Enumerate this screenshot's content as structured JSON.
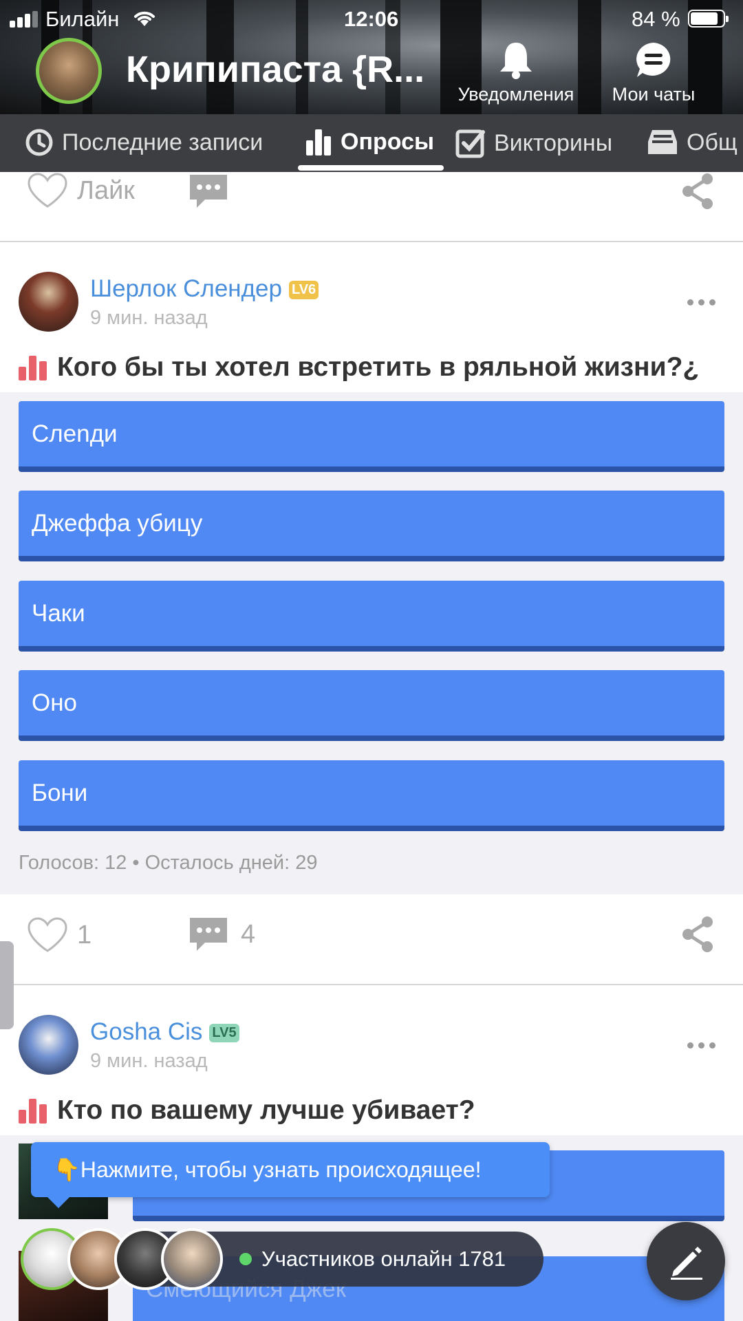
{
  "status_bar": {
    "carrier": "Билайн",
    "time": "12:06",
    "battery_text": "84 %"
  },
  "header": {
    "community_title": "Крипипаста {R...",
    "notifications_label": "Уведомления",
    "chats_label": "Мои чаты"
  },
  "tabs": [
    {
      "label": "Последние записи",
      "icon": "clock-icon",
      "active": false
    },
    {
      "label": "Опросы",
      "icon": "bar-chart-icon",
      "active": true
    },
    {
      "label": "Викторины",
      "icon": "checkbox-icon",
      "active": false
    },
    {
      "label": "Общ",
      "icon": "inbox-icon",
      "active": false
    }
  ],
  "prev_post_actions": {
    "like_label": "Лайк"
  },
  "posts": [
    {
      "author": "Шерлок Слендер",
      "level": "LV6",
      "time": "9 мин. назад",
      "title": "Кого бы ты хотел встретить в ряльной жизни?¿",
      "options": [
        "Слenди",
        "Джеффа убицу",
        "Чаки",
        "Оно",
        "Бони"
      ],
      "votes_text": "Голосов: 12 • Осталось дней: 29",
      "likes": "1",
      "comments": "4"
    },
    {
      "author": "Gosha Cis",
      "level": "LV5",
      "time": "9 мин. назад",
      "title": "Кто по вашему лучше убивает?",
      "options": [
        "",
        "Смеющийся Джек"
      ]
    }
  ],
  "tooltip": {
    "text": "👇Нажмите, чтобы узнать происходящее!"
  },
  "online": {
    "text": "Участников онлайн 1781"
  },
  "colors": {
    "accent_blue": "#5089f3",
    "tab_bar": "#3d3e42",
    "author_link": "#4a8fdb",
    "online_green": "#5ed66a"
  }
}
